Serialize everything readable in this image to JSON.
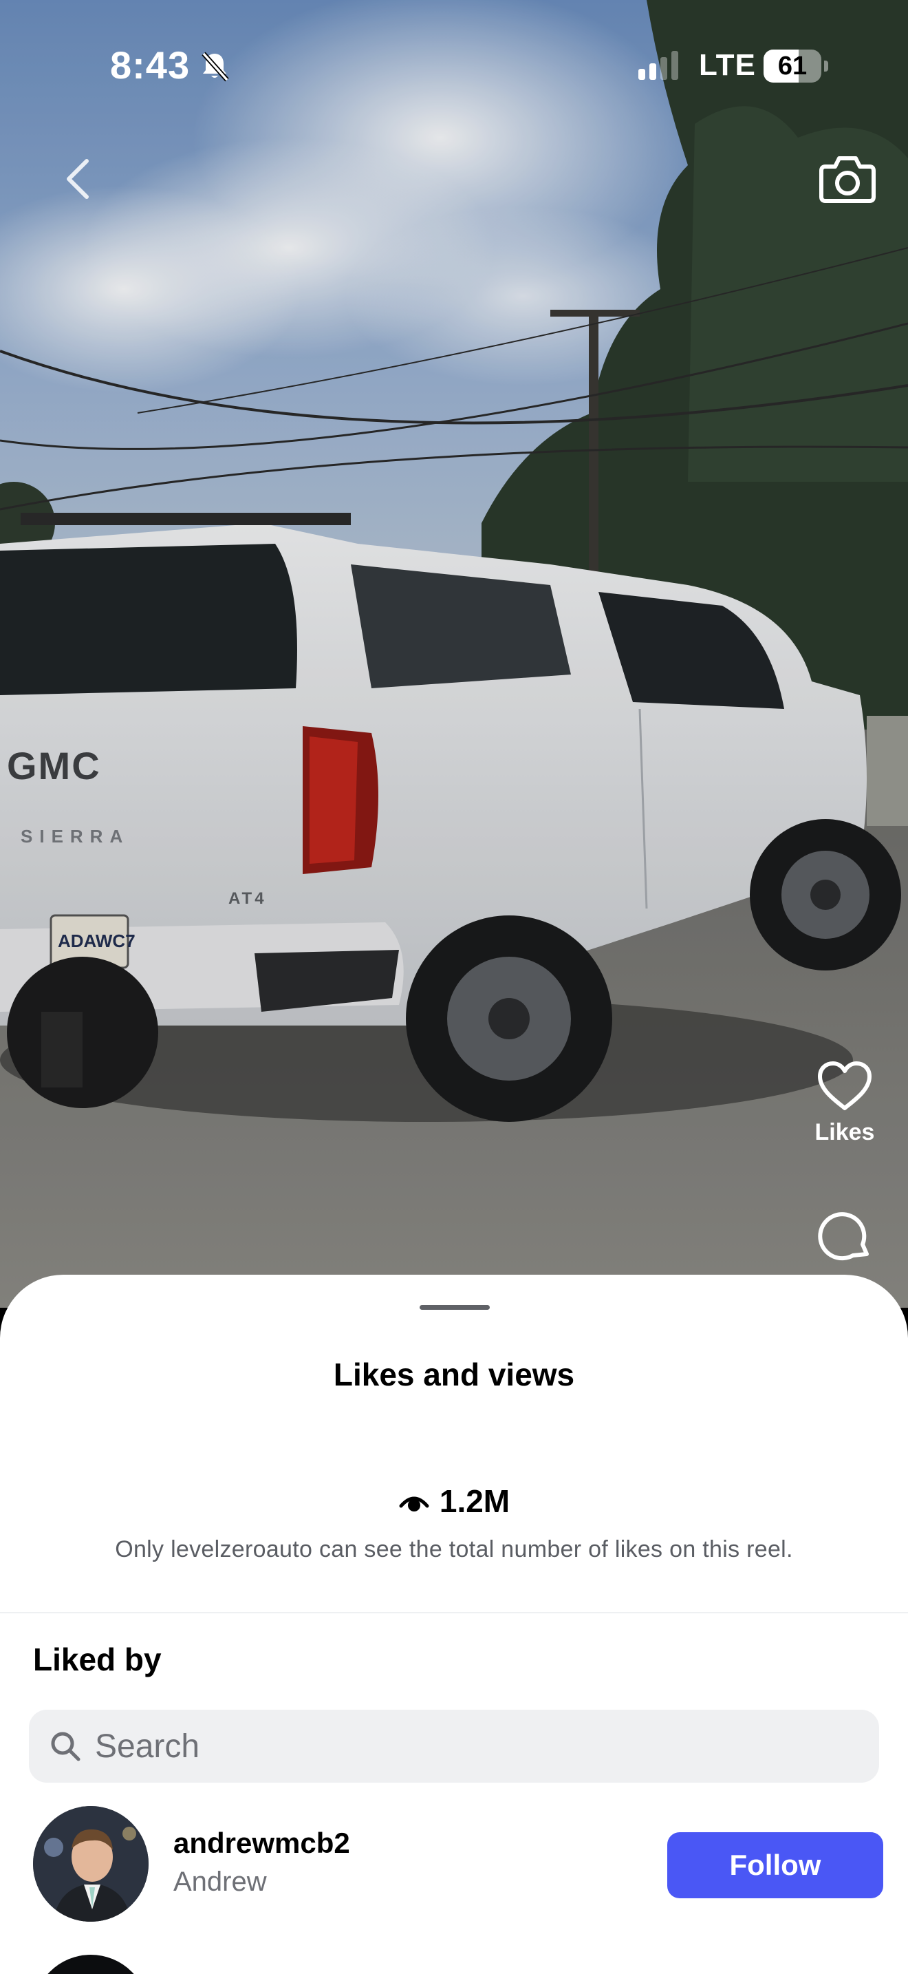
{
  "status_bar": {
    "time": "8:43",
    "network": "LTE",
    "battery_percent": "61",
    "battery_level": 0.61,
    "icons": {
      "silent": "bell-slash-icon",
      "signal": "cellular-signal-icon"
    }
  },
  "reel": {
    "icons": {
      "back": "chevron-left-icon",
      "camera": "camera-icon",
      "like": "heart-icon",
      "comment": "comment-icon"
    },
    "like_label": "Likes",
    "vehicle_badge": "GMC",
    "vehicle_model": "SIERRA",
    "trim_badge": "AT4",
    "plate": "ADAWC7"
  },
  "sheet": {
    "title": "Likes and views",
    "views_icon": "eye-icon",
    "views_count": "1.2M",
    "views_note": "Only levelzeroauto can see the total number of likes on this reel.",
    "liked_by_heading": "Liked by",
    "search": {
      "placeholder": "Search",
      "value": ""
    },
    "users": [
      {
        "username": "andrewmcb2",
        "full_name": "Andrew",
        "button_label": "Follow"
      }
    ]
  },
  "colors": {
    "follow_button": "#4a57f5",
    "sheet_background": "#ffffff",
    "search_background": "#eff0f2",
    "secondary_text": "#6e7076"
  }
}
